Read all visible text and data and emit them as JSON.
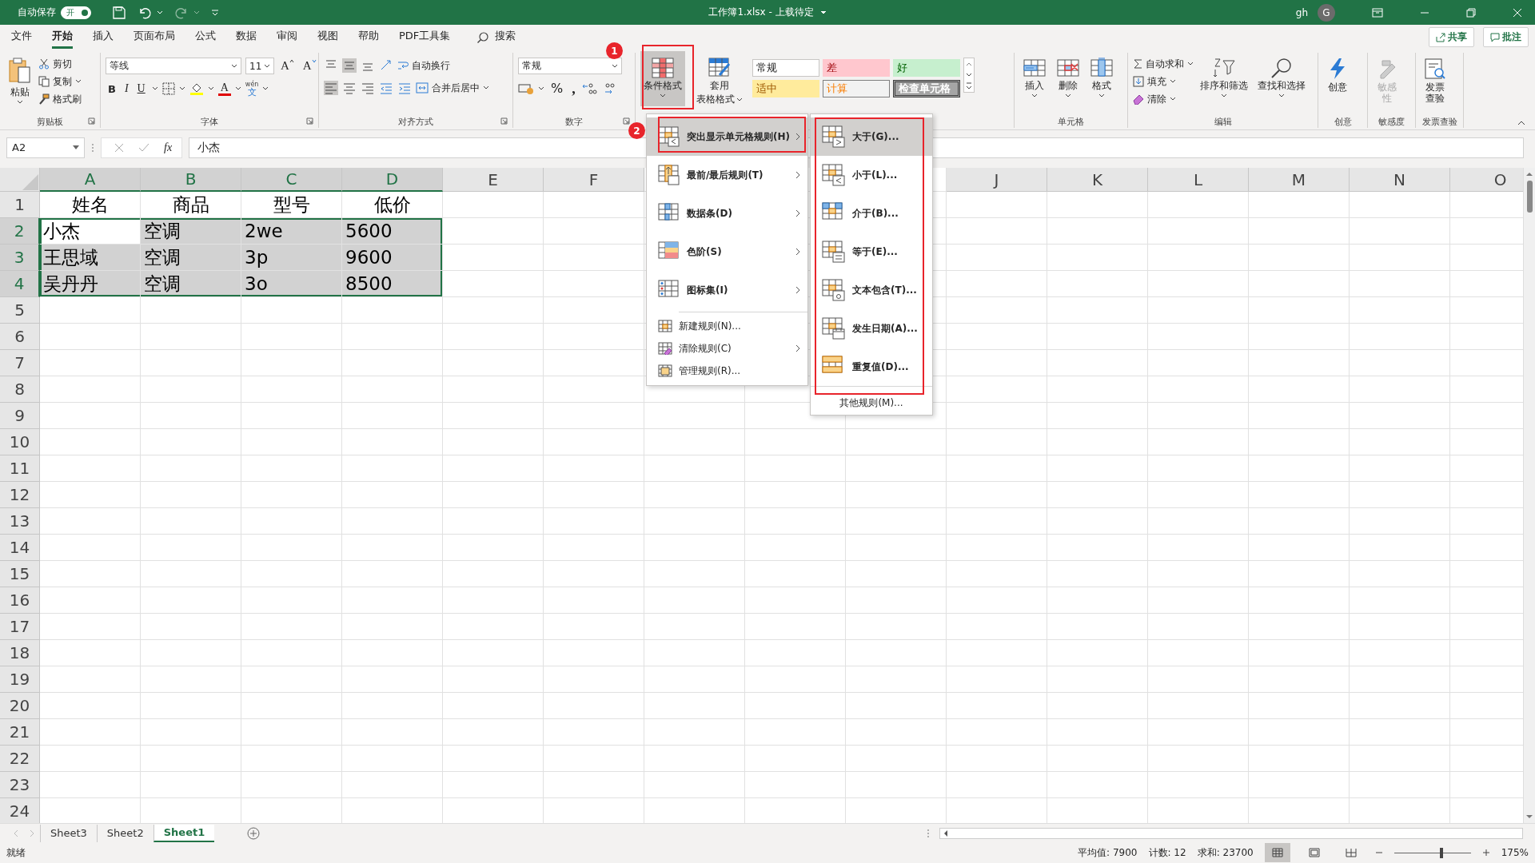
{
  "title_bar": {
    "autosave": "自动保存",
    "toggle": {
      "label": "开",
      "on": true
    },
    "title": "工作簿1.xlsx - 上载待定",
    "user": "gh",
    "avatar": "G"
  },
  "menu_tabs": [
    {
      "label": "文件",
      "selected": false
    },
    {
      "label": "开始",
      "selected": true
    },
    {
      "label": "插入",
      "selected": false
    },
    {
      "label": "页面布局",
      "selected": false
    },
    {
      "label": "公式",
      "selected": false
    },
    {
      "label": "数据",
      "selected": false
    },
    {
      "label": "审阅",
      "selected": false
    },
    {
      "label": "视图",
      "selected": false
    },
    {
      "label": "帮助",
      "selected": false
    },
    {
      "label": "PDF工具集",
      "selected": false
    }
  ],
  "search": "搜索",
  "share": "共享",
  "comments": "批注",
  "ribbon": {
    "clipboard": {
      "paste": "粘贴",
      "cut": "剪切",
      "copy": "复制",
      "painter": "格式刷",
      "label": "剪贴板"
    },
    "font": {
      "name": "等线",
      "size": "11",
      "grow": "A",
      "shrink": "A",
      "bold": "B",
      "italic": "I",
      "underline": "U",
      "font_color": "A",
      "phonetic": "wén",
      "phonetic_char": "文",
      "label": "字体"
    },
    "alignment": {
      "wrap": "自动换行",
      "merge": "合并后居中",
      "label": "对齐方式"
    },
    "number": {
      "format": "常规",
      "percent": "%",
      "comma": ",",
      "label": "数字"
    },
    "styles": {
      "conditional": "条件格式",
      "table": "套用",
      "table_2": "表格格式",
      "gallery": [
        {
          "label": "常规",
          "kind": "normal"
        },
        {
          "label": "差",
          "kind": "bad"
        },
        {
          "label": "好",
          "kind": "good"
        },
        {
          "label": "适中",
          "kind": "neutral"
        },
        {
          "label": "计算",
          "kind": "calculation"
        },
        {
          "label": "检查单元格",
          "kind": "check"
        }
      ]
    },
    "cells": {
      "buttons": [
        {
          "label": "插入",
          "kind": "insert"
        },
        {
          "label": "删除",
          "kind": "delete"
        },
        {
          "label": "格式",
          "kind": "format"
        }
      ],
      "label": "单元格"
    },
    "editing": {
      "autosum": "自动求和",
      "fill": "填充",
      "clear": "清除",
      "sort": "排序和筛选",
      "find": "查找和选择",
      "label": "编辑"
    },
    "extras": [
      {
        "button": "创意",
        "label": "创意",
        "disabled": false,
        "kind": "ideas"
      },
      {
        "button": "敏感性",
        "label": "敏感度",
        "disabled": true,
        "kind": "sensitivity"
      },
      {
        "button": "发票查验",
        "label": "发票查验",
        "disabled": false,
        "kind": "invoice"
      }
    ]
  },
  "formula_bar": {
    "name_box": "A2",
    "fx": "fx",
    "value": "小杰"
  },
  "sheet": {
    "columns": [
      "A",
      "B",
      "C",
      "D",
      "E",
      "F",
      null,
      null,
      null,
      "J",
      "K",
      "L",
      "M",
      "N",
      "O"
    ],
    "rows": [
      {
        "number": "1",
        "centered": true,
        "cells": [
          {
            "text": "姓名",
            "selected": false
          },
          {
            "text": "商品",
            "selected": false
          },
          {
            "text": "型号",
            "selected": false
          },
          {
            "text": "低价",
            "selected": false
          }
        ]
      },
      {
        "number": "2",
        "centered": false,
        "cells": [
          {
            "text": "小杰",
            "selected": true,
            "active": true
          },
          {
            "text": "空调",
            "selected": true
          },
          {
            "text": "2we",
            "selected": true
          },
          {
            "text": "5600",
            "selected": true
          }
        ]
      },
      {
        "number": "3",
        "centered": false,
        "cells": [
          {
            "text": "王思域",
            "selected": true
          },
          {
            "text": "空调",
            "selected": true
          },
          {
            "text": "3p",
            "selected": true
          },
          {
            "text": "9600",
            "selected": true
          }
        ]
      },
      {
        "number": "4",
        "centered": false,
        "cells": [
          {
            "text": "吴丹丹",
            "selected": true
          },
          {
            "text": "空调",
            "selected": true
          },
          {
            "text": "3o",
            "selected": true
          },
          {
            "text": "8500",
            "selected": true
          }
        ]
      },
      {
        "number": "5"
      },
      {
        "number": "6"
      },
      {
        "number": "7"
      },
      {
        "number": "8"
      },
      {
        "number": "9"
      },
      {
        "number": "10"
      },
      {
        "number": "11"
      },
      {
        "number": "12"
      },
      {
        "number": "13"
      },
      {
        "number": "14"
      },
      {
        "number": "15"
      },
      {
        "number": "16"
      },
      {
        "number": "17"
      },
      {
        "number": "18"
      },
      {
        "number": "19"
      },
      {
        "number": "20"
      },
      {
        "number": "21"
      },
      {
        "number": "22"
      },
      {
        "number": "23"
      },
      {
        "number": "24"
      }
    ]
  },
  "sheet_tabs": [
    {
      "label": "Sheet3",
      "selected": false
    },
    {
      "label": "Sheet2",
      "selected": false
    },
    {
      "label": "Sheet1",
      "selected": true
    }
  ],
  "status_bar": {
    "ready": "就绪",
    "average": "平均值: 7900",
    "count": "计数: 12",
    "sum": "求和: 23700",
    "zoom": "175%",
    "zoom_slider": {
      "level": 0.64
    },
    "views": [
      {
        "kind": "normal",
        "selected": true
      },
      {
        "kind": "page_layout",
        "selected": false
      },
      {
        "kind": "page_break",
        "selected": false
      }
    ]
  },
  "cond_menu": {
    "sections": [
      [
        {
          "label": "突出显示单元格规则(H)",
          "kind": "highlight",
          "submenu": true,
          "selected": true
        },
        {
          "label": "最前/最后规则(T)",
          "kind": "topbottom",
          "submenu": true,
          "selected": false
        },
        {
          "label": "数据条(D)",
          "kind": "databar",
          "submenu": true,
          "selected": false
        },
        {
          "label": "色阶(S)",
          "kind": "colorscale",
          "submenu": true,
          "selected": false
        },
        {
          "label": "图标集(I)",
          "kind": "iconset",
          "submenu": true,
          "selected": false
        }
      ],
      [
        {
          "label": "新建规则(N)...",
          "kind": "new",
          "submenu": false,
          "selected": false
        },
        {
          "label": "清除规则(C)",
          "kind": "clear",
          "submenu": true,
          "selected": false
        },
        {
          "label": "管理规则(R)...",
          "kind": "manage",
          "submenu": false,
          "selected": false
        }
      ]
    ],
    "submenu": [
      {
        "label": "大于(G)...",
        "kind": "greater",
        "selected": true
      },
      {
        "label": "小于(L)...",
        "kind": "less",
        "selected": false
      },
      {
        "label": "介于(B)...",
        "kind": "between",
        "selected": false
      },
      {
        "label": "等于(E)...",
        "kind": "equal",
        "selected": false
      },
      {
        "label": "文本包含(T)...",
        "kind": "text",
        "selected": false
      },
      {
        "label": "发生日期(A)...",
        "kind": "date",
        "selected": false
      },
      {
        "label": "重复值(D)...",
        "kind": "duplicate",
        "selected": false
      }
    ],
    "more": "其他规则(M)..."
  },
  "annotations": [
    {
      "label": "1",
      "kind": "conditional"
    },
    {
      "label": "2",
      "kind": "highlight"
    }
  ]
}
